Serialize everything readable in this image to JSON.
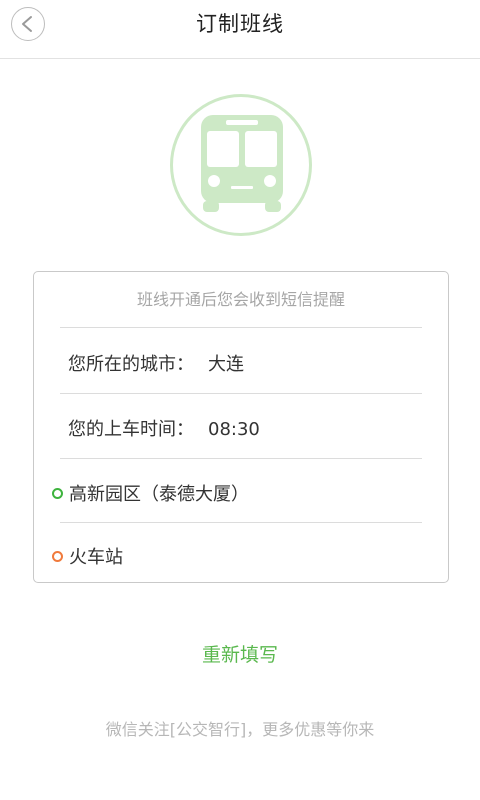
{
  "header": {
    "title": "订制班线",
    "back_icon": "back-arrow-icon"
  },
  "hero": {
    "icon": "bus-icon",
    "accent_color": "#cde9c6"
  },
  "card": {
    "notice": "班线开通后您会收到短信提醒",
    "city_label": "您所在的城市：",
    "city_value": "大连",
    "time_label": "您的上车时间：",
    "time_value": "08:30",
    "start_stop": "高新园区（泰德大厦）",
    "end_stop": "火车站",
    "start_color": "#3db33d",
    "end_color": "#f07a3c"
  },
  "actions": {
    "refill_label": "重新填写"
  },
  "footer": {
    "text": "微信关注[公交智行]，更多优惠等你来"
  }
}
